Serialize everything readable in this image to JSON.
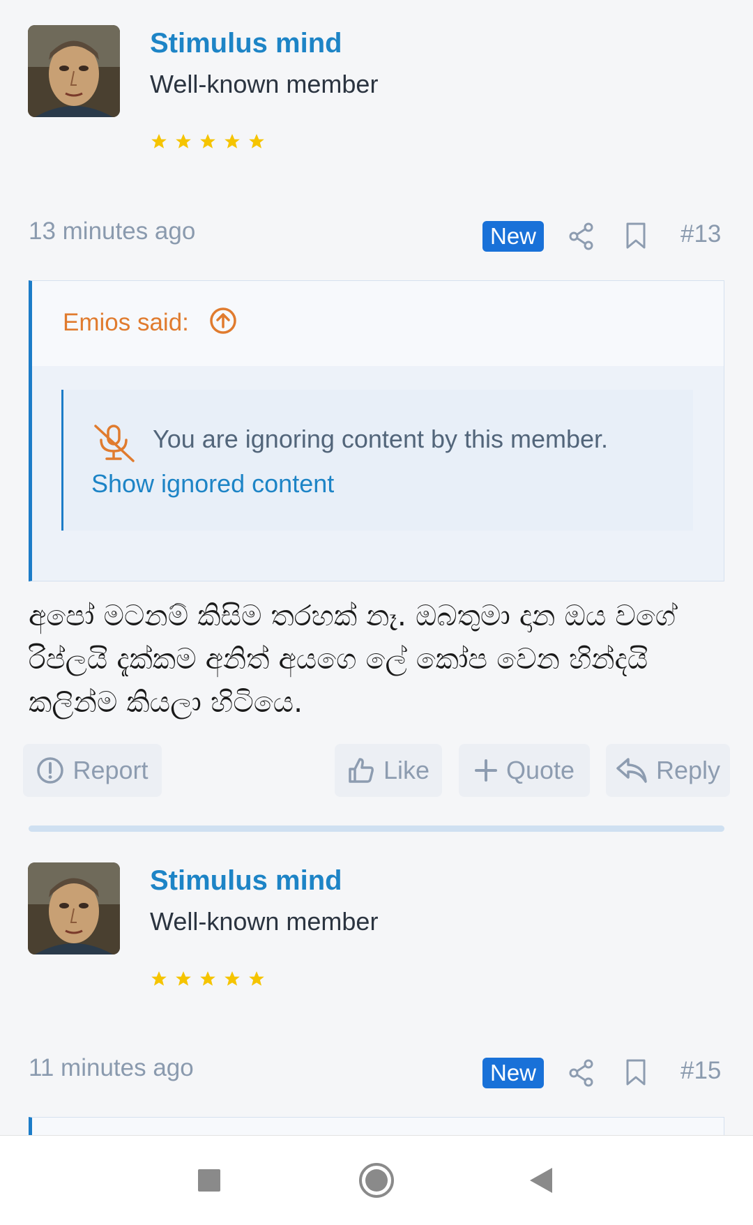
{
  "posts": [
    {
      "user": {
        "name": "Stimulus mind",
        "title": "Well-known member",
        "stars": 5
      },
      "time": "13 minutes ago",
      "badge": "New",
      "number": "#13",
      "quote": {
        "author": "Emios said:",
        "ignored_text": "You are ignoring content by this member.",
        "show_link": "Show ignored content"
      },
      "message": "අපෝ මටනම් කිසිම තරහක් නෑ. ඔබතුමා දාන ඔය වගේ රිප්ලයි දැක්කම අනිත් අයගෙ ලේ කෝප වෙන හින්දයි කලින්ම කියලා හිටියෙ.",
      "actions": {
        "report": "Report",
        "like": "Like",
        "quote": "Quote",
        "reply": "Reply"
      }
    },
    {
      "user": {
        "name": "Stimulus mind",
        "title": "Well-known member",
        "stars": 5
      },
      "time": "11 minutes ago",
      "badge": "New",
      "number": "#15"
    }
  ],
  "colors": {
    "accent": "#1d84c6",
    "badge": "#1971d8",
    "quote_author": "#e07b2e",
    "star": "#f5c400"
  },
  "icons": [
    "share-icon",
    "bookmark-icon",
    "arrow-up-circle-icon",
    "mute-icon",
    "report-icon",
    "thumbs-up-icon",
    "plus-icon",
    "reply-icon",
    "nav-recents-icon",
    "nav-home-icon",
    "nav-back-icon"
  ]
}
